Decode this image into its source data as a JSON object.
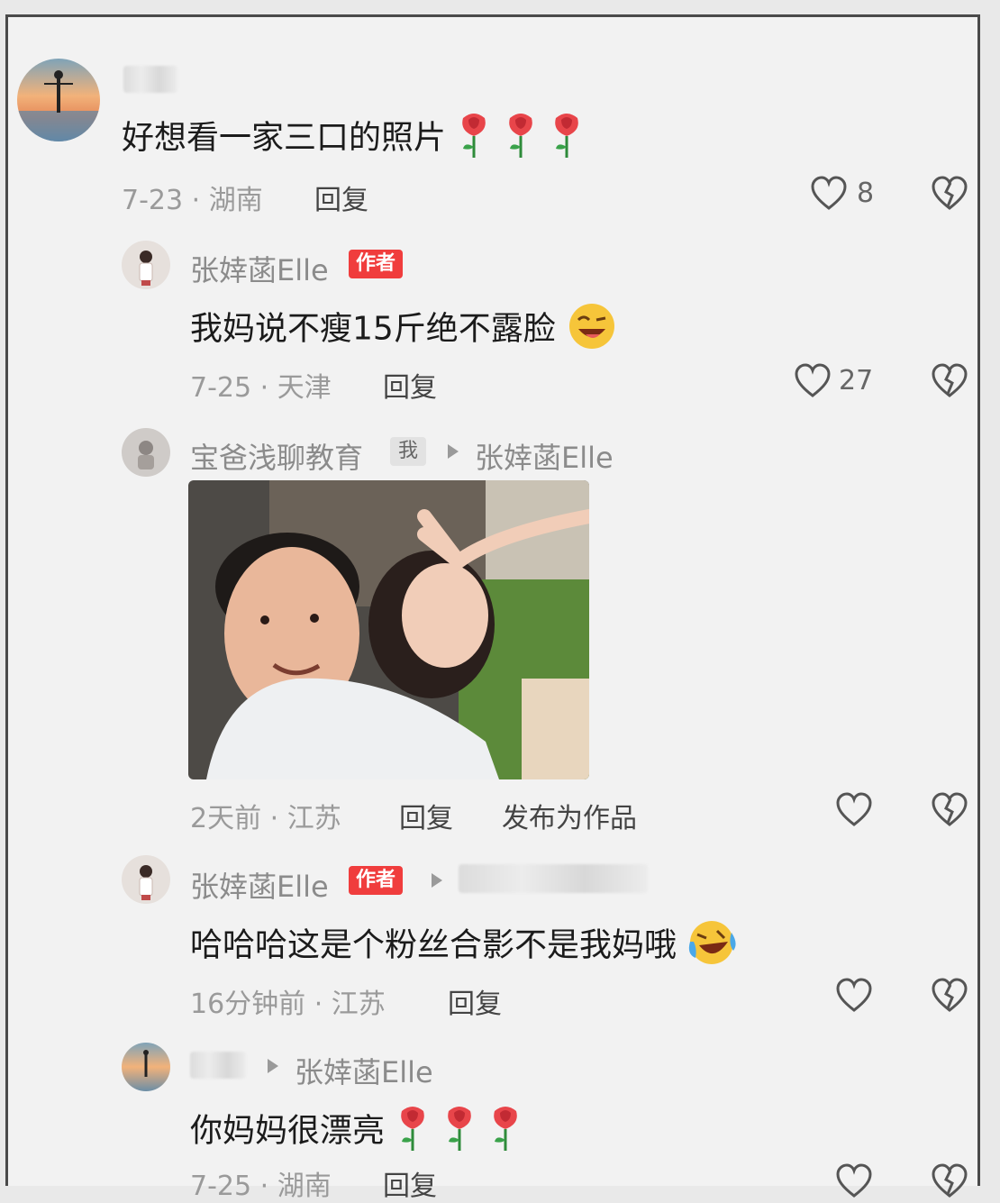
{
  "comments": [
    {
      "avatar": "sunset-figure-avatar",
      "content": "好想看一家三口的照片",
      "emoji": [
        "rose",
        "rose",
        "rose"
      ],
      "meta": "7-23 · 湖南",
      "reply": "回复",
      "likes": "8"
    },
    {
      "name": "张婞菡Elle",
      "badge": "作者",
      "content": "我妈说不瘦15斤绝不露脸",
      "emoji": [
        "grinning-wink-face"
      ],
      "meta": "7-25 · 天津",
      "reply": "回复",
      "likes": "27"
    },
    {
      "name": "宝爸浅聊教育",
      "badge_me": "我",
      "reply_to": "张婞菡Elle",
      "photo": "selfie-man-and-woman",
      "meta": "2天前 · 江苏",
      "reply": "回复",
      "publish": "发布为作品"
    },
    {
      "name": "张婞菡Elle",
      "badge": "作者",
      "content": "哈哈哈这是个粉丝合影不是我妈哦",
      "emoji": [
        "laughing-tears-face"
      ],
      "meta": "16分钟前 · 江苏",
      "reply": "回复"
    },
    {
      "reply_to": "张婞菡Elle",
      "content": "你妈妈很漂亮",
      "emoji": [
        "rose",
        "rose",
        "rose"
      ],
      "meta": "7-25 · 湖南",
      "reply": "回复"
    }
  ],
  "colors": {
    "author_badge": "#f03d3d",
    "text": "#1b1b1b",
    "meta": "#9a9a9a",
    "bg": "#f2f2f2"
  }
}
